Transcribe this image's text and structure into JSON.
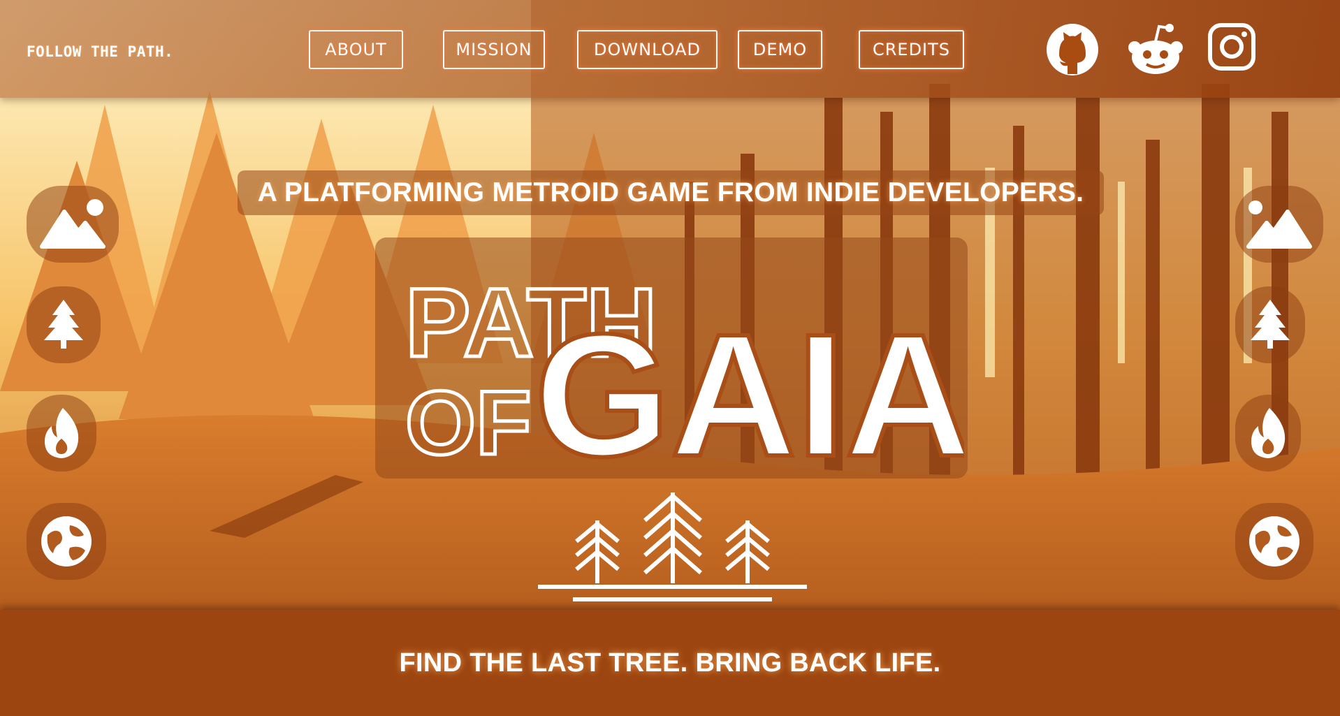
{
  "header": {
    "tagline": "FOLLOW THE PATH.",
    "nav": [
      {
        "label": "ABOUT"
      },
      {
        "label": "MISSION"
      },
      {
        "label": "DOWNLOAD"
      },
      {
        "label": "DEMO"
      },
      {
        "label": "CREDITS"
      }
    ],
    "social": [
      {
        "icon": "github-icon"
      },
      {
        "icon": "reddit-icon"
      },
      {
        "icon": "instagram-icon"
      }
    ]
  },
  "hero": {
    "subtitle": "A PLATFORMING METROID GAME FROM INDIE DEVELOPERS.",
    "logo": {
      "line1": "PATH",
      "line2": "OF",
      "main": "GAIA"
    }
  },
  "side_buttons": {
    "left": [
      {
        "icon": "mountain-icon"
      },
      {
        "icon": "tree-icon"
      },
      {
        "icon": "fire-icon"
      },
      {
        "icon": "earth-icon"
      }
    ],
    "right": [
      {
        "icon": "mountain-icon"
      },
      {
        "icon": "tree-icon"
      },
      {
        "icon": "fire-icon"
      },
      {
        "icon": "earth-icon"
      }
    ]
  },
  "footer": {
    "text": "FIND THE LAST TREE. BRING BACK LIFE."
  },
  "colors": {
    "accent": "#e8742a",
    "dark": "#9c4510",
    "light": "#fff3c4"
  }
}
